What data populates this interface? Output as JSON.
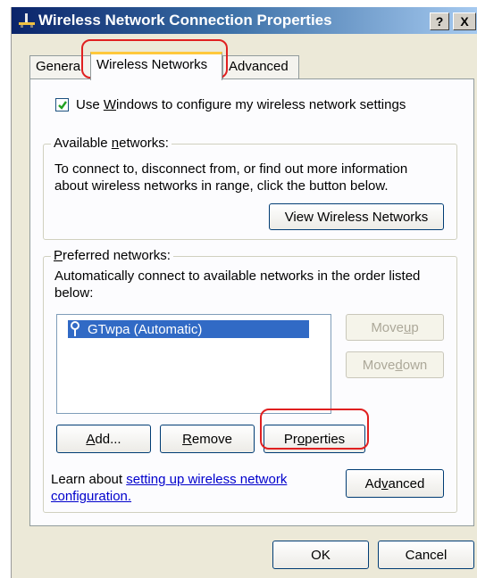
{
  "window": {
    "title": "Wireless Network Connection Properties",
    "help_button": "?",
    "close_button": "X"
  },
  "tabs": [
    {
      "label": "General",
      "active": false
    },
    {
      "label": "Wireless Networks",
      "active": true
    },
    {
      "label": "Advanced",
      "active": false
    }
  ],
  "use_windows": {
    "checked": true,
    "label_before": "Use ",
    "label_u": "W",
    "label_after": "indows to configure my wireless network settings"
  },
  "available": {
    "legend_before": "Available ",
    "legend_u": "n",
    "legend_after": "etworks:",
    "line1": "To connect to, disconnect from, or find out more information",
    "line2": "about wireless networks in range, click the button below.",
    "view_button": "View Wireless Networks"
  },
  "preferred": {
    "legend_u": "P",
    "legend_after": "referred networks:",
    "line1": "Automatically connect to available networks in the order listed",
    "line2": "below:",
    "networks": [
      "GTwpa (Automatic)"
    ],
    "move_up": {
      "before": "Move ",
      "u": "u",
      "after": "p"
    },
    "move_down": {
      "before": "Move ",
      "u": "d",
      "after": "own"
    },
    "add": {
      "u": "A",
      "after": "dd..."
    },
    "remove": {
      "u": "R",
      "after": "emove"
    },
    "properties": {
      "before": "Pr",
      "u": "o",
      "after": "perties"
    },
    "learn_text": "Learn about ",
    "learn_link1": "setting up wireless network",
    "learn_link2": "configuration.",
    "advanced": {
      "before": "Ad",
      "u": "v",
      "after": "anced"
    }
  },
  "footer": {
    "ok": "OK",
    "cancel": "Cancel"
  },
  "colors": {
    "highlight_ring": "#e02020",
    "selection": "#316ac5",
    "titlebar": "#0a246a"
  }
}
